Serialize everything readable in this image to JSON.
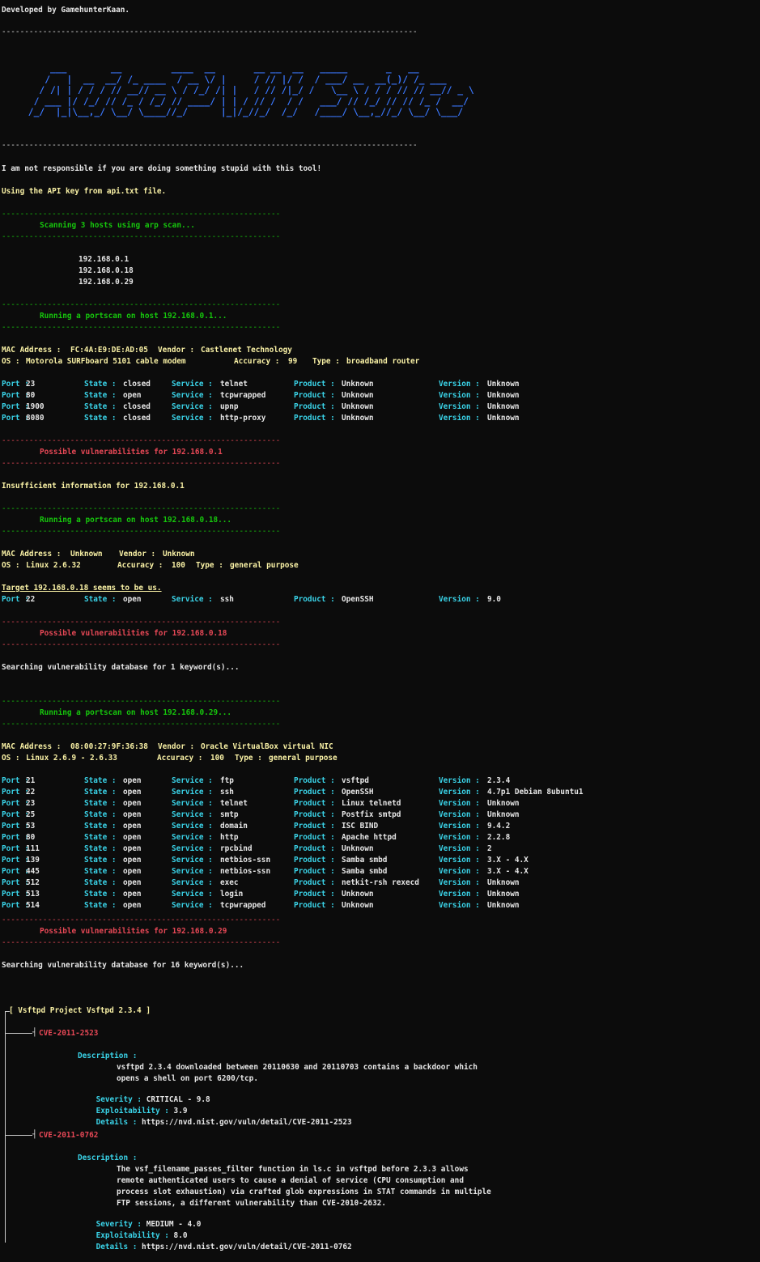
{
  "header": {
    "credit": "Developed by GamehunterKaan.",
    "separator_long": "-------------------------------------------------------------------------------------------",
    "ascii_banner": "     ___        __         ____  __       __ __  __   _____       _   __\n    /   |  __  __/ /_ ____  / __ \\/ |     / // |/ /  / ___/ __  __(_)/ /_ ___\n   / /| | / / / // __// __ \\ / /_/ /| |   / // /|_/ /   \\__ \\ / / / // // __// _ \\\n  / ___ |/ /_/ // /_ / /_/ // ____/ | | / // /  / /   ___/ // /_/ // // /_ /  __/\n /_/  |_|\\__,_/ \\__/ \\____//_/      |_|/_//_/  /_/   /____/ \\__,_//_/ \\__/ \\___/",
    "disclaimer": "I am not responsible if you are doing something stupid with this tool!",
    "api_notice": "Using the API key from api.txt file."
  },
  "separator_short": "-------------------------------------------------------------",
  "arp_scan": {
    "title": "Scanning 3 hosts using arp scan...",
    "hosts": [
      "192.168.0.1",
      "192.168.0.18",
      "192.168.0.29"
    ]
  },
  "labels": {
    "port": "Port :",
    "state": "State :",
    "service": "Service :",
    "product": "Product :",
    "version": "Version :",
    "mac": "MAC Address :",
    "vendor": "Vendor :",
    "os": "OS :",
    "accuracy": "Accuracy :",
    "type": "Type :",
    "description": "Description :",
    "severity": "Severity :",
    "exploitability": "Exploitability :",
    "details": "Details :"
  },
  "host1": {
    "scan_title": "Running a portscan on host 192.168.0.1...",
    "mac": "FC:4A:E9:DE:AD:05",
    "vendor": "Castlenet Technology",
    "os": "Motorola SURFboard 5101 cable modem",
    "accuracy": "99",
    "type": "broadband router",
    "ports": [
      {
        "port": "23",
        "state": "closed",
        "service": "telnet",
        "product": "Unknown",
        "version": "Unknown"
      },
      {
        "port": "80",
        "state": "open",
        "service": "tcpwrapped",
        "product": "Unknown",
        "version": "Unknown"
      },
      {
        "port": "1900",
        "state": "closed",
        "service": "upnp",
        "product": "Unknown",
        "version": "Unknown"
      },
      {
        "port": "8080",
        "state": "closed",
        "service": "http-proxy",
        "product": "Unknown",
        "version": "Unknown"
      }
    ],
    "vuln_title": "Possible vulnerabilities for 192.168.0.1",
    "vuln_result": "Insufficient information for 192.168.0.1"
  },
  "host2": {
    "scan_title": "Running a portscan on host 192.168.0.18...",
    "mac": "Unknown",
    "vendor": "Unknown",
    "os": "Linux 2.6.32",
    "accuracy": "100",
    "type": "general purpose",
    "self_note": "Target 192.168.0.18 seems to be us.",
    "ports": [
      {
        "port": "22",
        "state": "open",
        "service": "ssh",
        "product": "OpenSSH",
        "version": "9.0"
      }
    ],
    "vuln_title": "Possible vulnerabilities for 192.168.0.18",
    "vuln_result": "Searching vulnerability database for 1 keyword(s)..."
  },
  "host3": {
    "scan_title": "Running a portscan on host 192.168.0.29...",
    "mac": "08:00:27:9F:36:38",
    "vendor": "Oracle VirtualBox virtual NIC",
    "os": "Linux 2.6.9 - 2.6.33",
    "accuracy": "100",
    "type": "general purpose",
    "ports": [
      {
        "port": "21",
        "state": "open",
        "service": "ftp",
        "product": "vsftpd",
        "version": "2.3.4"
      },
      {
        "port": "22",
        "state": "open",
        "service": "ssh",
        "product": "OpenSSH",
        "version": "4.7p1 Debian 8ubuntu1"
      },
      {
        "port": "23",
        "state": "open",
        "service": "telnet",
        "product": "Linux telnetd",
        "version": "Unknown"
      },
      {
        "port": "25",
        "state": "open",
        "service": "smtp",
        "product": "Postfix smtpd",
        "version": "Unknown"
      },
      {
        "port": "53",
        "state": "open",
        "service": "domain",
        "product": "ISC BIND",
        "version": "9.4.2"
      },
      {
        "port": "80",
        "state": "open",
        "service": "http",
        "product": "Apache httpd",
        "version": "2.2.8"
      },
      {
        "port": "111",
        "state": "open",
        "service": "rpcbind",
        "product": "Unknown",
        "version": "2"
      },
      {
        "port": "139",
        "state": "open",
        "service": "netbios-ssn",
        "product": "Samba smbd",
        "version": "3.X - 4.X"
      },
      {
        "port": "445",
        "state": "open",
        "service": "netbios-ssn",
        "product": "Samba smbd",
        "version": "3.X - 4.X"
      },
      {
        "port": "512",
        "state": "open",
        "service": "exec",
        "product": "netkit-rsh rexecd",
        "version": "Unknown"
      },
      {
        "port": "513",
        "state": "open",
        "service": "login",
        "product": "Unknown",
        "version": "Unknown"
      },
      {
        "port": "514",
        "state": "open",
        "service": "tcpwrapped",
        "product": "Unknown",
        "version": "Unknown"
      }
    ],
    "vuln_title": "Possible vulnerabilities for 192.168.0.29",
    "vuln_result": "Searching vulnerability database for 16 keyword(s)..."
  },
  "vuln_tree": {
    "product_heading": "[ Vsftpd Project Vsftpd 2.3.4 ]",
    "cves": [
      {
        "id": "CVE-2011-2523",
        "description": [
          "vsftpd 2.3.4 downloaded between 20110630 and 20110703 contains a backdoor which",
          "opens a shell on port 6200/tcp."
        ],
        "severity": "CRITICAL - 9.8",
        "exploitability": "3.9",
        "details": "https://nvd.nist.gov/vuln/detail/CVE-2011-2523"
      },
      {
        "id": "CVE-2011-0762",
        "description": [
          "The vsf_filename_passes_filter function in ls.c in vsftpd before 2.3.3 allows",
          "remote authenticated users to cause a denial of service (CPU consumption and",
          "process slot exhaustion) via crafted glob expressions in STAT commands in multiple",
          "FTP sessions, a different vulnerability than CVE-2010-2632."
        ],
        "severity": "MEDIUM - 4.0",
        "exploitability": "8.0",
        "details": "https://nvd.nist.gov/vuln/detail/CVE-2011-0762"
      }
    ]
  },
  "colors": {
    "background": "#0c0c0c",
    "yellow": "#f9f1a5",
    "green": "#16c60c",
    "cyan": "#3ad3e8",
    "red": "#e74856",
    "blue": "#3b78ff"
  }
}
